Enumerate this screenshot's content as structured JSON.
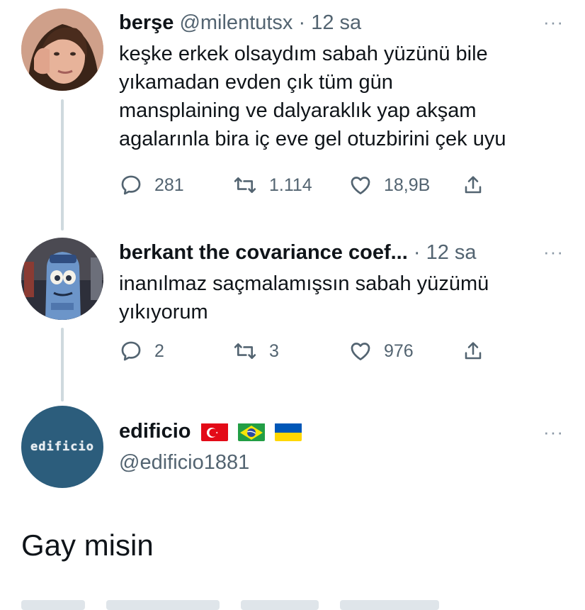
{
  "tweets": [
    {
      "name": "berşe",
      "handle": "@milentutsx",
      "separator": "·",
      "time": "12 sa",
      "text": "keşke erkek olsaydım sabah yüzünü bile\nyıkamadan evden çık tüm gün\nmansplaining ve dalyaraklık yap akşam\nagalarınla bira iç eve gel otuzbirini çek uyu",
      "replies": "281",
      "retweets": "1.114",
      "likes": "18,9B"
    },
    {
      "name": "berkant the covariance coef...",
      "separator": "·",
      "time": "12 sa",
      "text": "inanılmaz saçmalamışsın sabah yüzümü\nyıkıyorum",
      "replies": "2",
      "retweets": "3",
      "likes": "976"
    },
    {
      "name": "edificio",
      "handle": "@edificio1881",
      "avatar_label": "edificio",
      "flags": [
        "turkey-flag",
        "brazil-flag",
        "ukraine-flag"
      ]
    }
  ],
  "reply_text": "Gay misin",
  "more_label": "···",
  "icons": {
    "reply": "reply-icon",
    "retweet": "retweet-icon",
    "like": "heart-icon",
    "share": "share-icon"
  },
  "colors": {
    "text_primary": "#0f1419",
    "text_secondary": "#536471",
    "connector": "#cfd9de",
    "edificio_avatar": "#2c5d7c"
  }
}
